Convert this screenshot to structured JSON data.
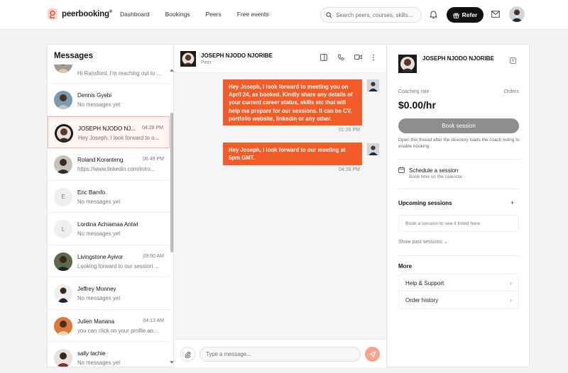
{
  "brand": {
    "name": "peerbooking",
    "mark": "®"
  },
  "nav": {
    "links": [
      "Dashboard",
      "Bookings",
      "Peers",
      "Free events"
    ]
  },
  "search": {
    "placeholder": "Search peers, courses, skills..."
  },
  "header": {
    "refer_label": "Refer"
  },
  "messages": {
    "title": "Messages",
    "conversations": [
      {
        "name": "",
        "time": "",
        "preview": "Hi Ransford, I'm reaching out to ..."
      },
      {
        "name": "Dennis Gyebi",
        "time": "",
        "preview": "No messages yet"
      },
      {
        "name": "JOSEPH NJODO NJ...",
        "time": "04:28 PM",
        "preview": "Hey Joseph, I look forward to o..."
      },
      {
        "name": "Roland Koranteng",
        "time": "06:49 PM",
        "preview": "https://www.linkedin.com/in/ro..."
      },
      {
        "name": "Eric Bamfo",
        "time": "",
        "preview": "No messages yet",
        "initial": "E"
      },
      {
        "name": "Lordina Achiamaa Antwi",
        "time": "",
        "preview": "No messages yet",
        "initial": "L"
      },
      {
        "name": "Livingstone Ayivor",
        "time": "09:50 AM",
        "preview": "Looking forward to our session ..."
      },
      {
        "name": "Jeffrey Monney",
        "time": "",
        "preview": "No messages yet"
      },
      {
        "name": "Julien Manana",
        "time": "04:13 AM",
        "preview": "you can click on your profile an..."
      },
      {
        "name": "sally tachie",
        "time": "",
        "preview": "No messages yet"
      }
    ]
  },
  "chat": {
    "name": "JOSEPH NJODO NJORIBE",
    "role": "Peer",
    "messages": [
      {
        "text": "Hey Joseph, I look forward to meeting you on April 24, as booked. Kindly share any details of your current career status, skills etc that will help me prepare for our sessions.  It can be CV, portfolio website, linkedin or any other.",
        "time": "01:26 PM"
      },
      {
        "text": "Hey Joseph, I look forward to our meeting at 5pm GMT.",
        "time": "04:28 PM"
      }
    ],
    "input_placeholder": "Type a message..."
  },
  "info": {
    "name": "JOSEPH NJODO NJORIBE",
    "rate_label": "Coaching rate",
    "orders_label": "Orders",
    "rate": "$0.00/hr",
    "book_label": "Book session",
    "note": "Open this thread after the directory loads the coach listing to enable booking.",
    "schedule_title": "Schedule a session",
    "schedule_sub": "Book time on the calendar",
    "upcoming_title": "Upcoming sessions",
    "upcoming_add": "+",
    "upcoming_empty": "Book a session to see it listed here.",
    "past_link": "Show past sessions ⌄",
    "more_title": "More",
    "more_items": [
      "Help & Support",
      "Order history"
    ]
  },
  "colors": {
    "accent": "#f35b27",
    "send": "#f6a489",
    "book_disabled": "#8e8e8e"
  }
}
